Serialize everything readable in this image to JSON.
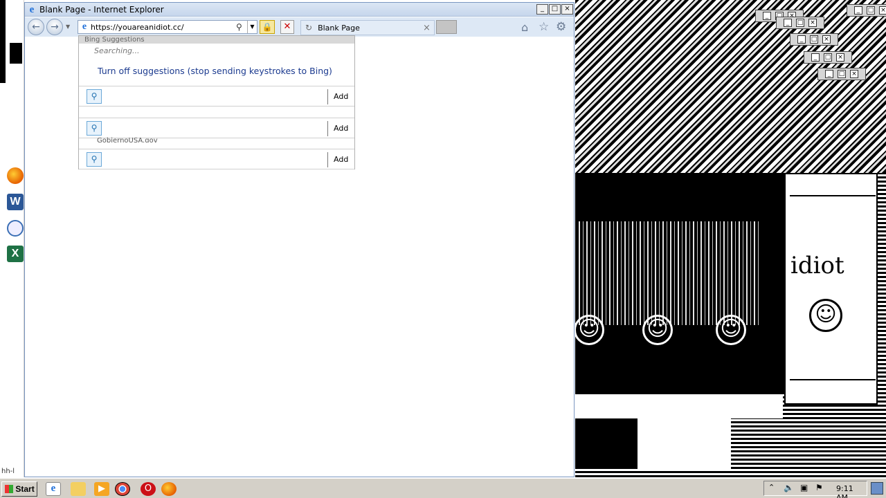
{
  "window": {
    "title": "Blank Page - Internet Explorer",
    "min_label": "_",
    "max_label": "□",
    "close_label": "×"
  },
  "address": {
    "url": "https://youareanidiot.cc/"
  },
  "tab": {
    "label": "Blank Page",
    "close": "×"
  },
  "suggestions": {
    "header": "Bing Suggestions",
    "searching": "Searching...",
    "turn_off": "Turn off suggestions (stop sending keystrokes to Bing)",
    "partial_text": "GobiernoUSA.gov",
    "rows": [
      {
        "add_label": "Add"
      },
      {
        "add_label": "Add"
      },
      {
        "add_label": "Add"
      }
    ]
  },
  "popup": {
    "text": "idiot",
    "smile": "☺"
  },
  "taskbar": {
    "start_label": "Start",
    "clock": "9:11 AM"
  },
  "desktop": {
    "corner_text": "hh-l"
  },
  "icons": {
    "back": "back-arrow-icon",
    "forward": "forward-arrow-icon",
    "home": "home-icon",
    "favorites": "star-icon",
    "tools": "gear-icon"
  }
}
